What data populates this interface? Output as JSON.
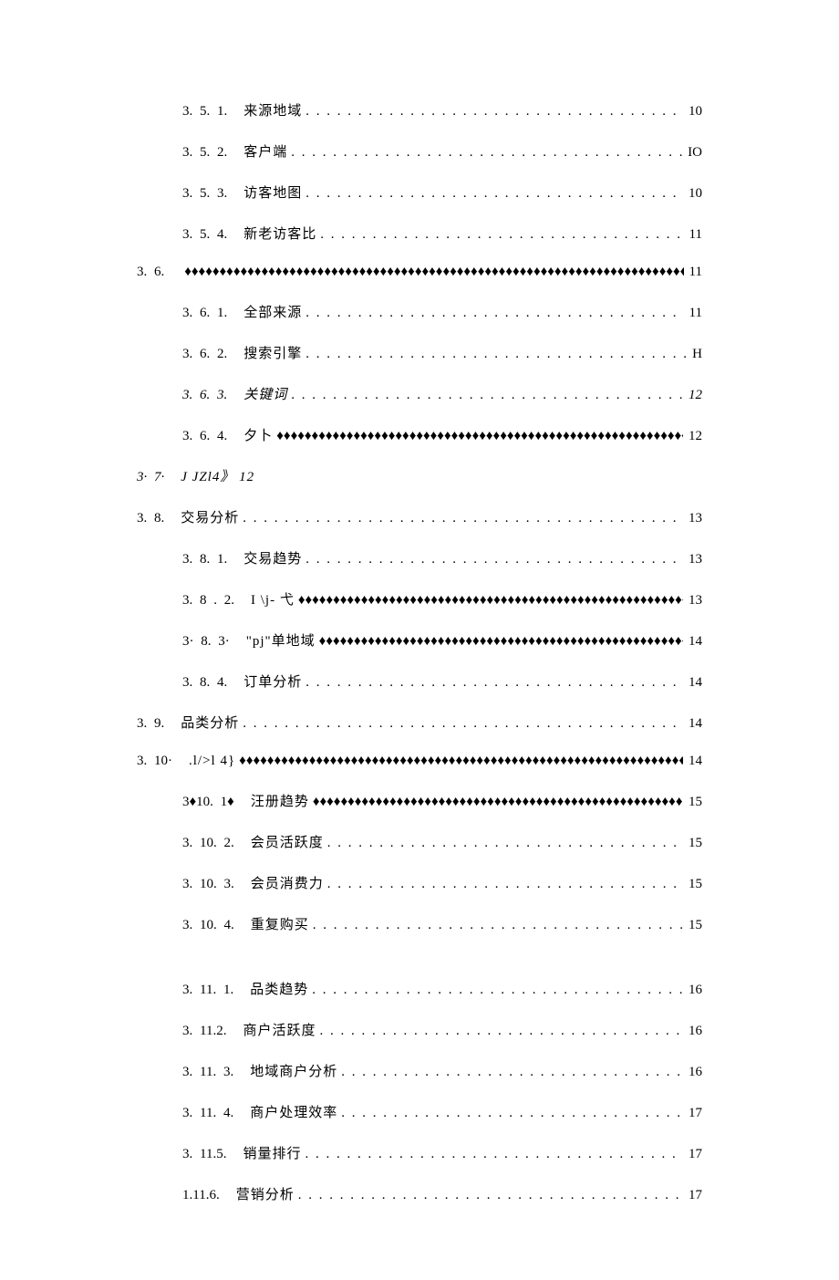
{
  "toc": [
    {
      "indent": 2,
      "num": "3. 5. 1.",
      "title": "来源地域",
      "leader": "dots",
      "page": "10",
      "italic": false
    },
    {
      "indent": 2,
      "num": "3. 5.  2.",
      "title": "客户端",
      "leader": "dots",
      "page": "IO",
      "italic": false
    },
    {
      "indent": 2,
      "num": "3. 5.  3.",
      "title": "访客地图",
      "leader": "dots",
      "page": "10",
      "italic": false
    },
    {
      "indent": 2,
      "num": "3. 5.  4.",
      "title": "新老访客比",
      "leader": "dots",
      "page": "11",
      "italic": false
    },
    {
      "indent": 1,
      "num": "3. 6.",
      "title": "",
      "leader": "diam",
      "page": "11",
      "italic": false
    },
    {
      "indent": 2,
      "num": "3. 6.  1.",
      "title": "全部来源",
      "leader": "dots",
      "page": "11",
      "italic": false
    },
    {
      "indent": 2,
      "num": "3. 6.  2.",
      "title": "搜索引擎",
      "leader": "dots",
      "page": "H",
      "italic": false
    },
    {
      "indent": 2,
      "num": "3. 6.  3.",
      "title": "关键词",
      "leader": "dots",
      "page": "12",
      "italic": true
    },
    {
      "indent": 2,
      "num": "3. 6. 4.",
      "title": "夕卜",
      "leader": "diam",
      "page": "12",
      "italic": false
    },
    {
      "indent": 1,
      "num": "3· 7·",
      "title": "J JZl4》 12",
      "leader": "none",
      "page": "",
      "italic": true
    },
    {
      "indent": 1,
      "num": "3. 8.",
      "title": "交易分析",
      "leader": "dots",
      "page": "13",
      "italic": false
    },
    {
      "indent": 2,
      "num": "3. 8. 1.",
      "title": "交易趋势",
      "leader": "dots",
      "page": "13",
      "italic": false
    },
    {
      "indent": 2,
      "num": "3. 8 . 2.",
      "title": "I \\j- 弋",
      "leader": "diam",
      "page": "13",
      "italic": false
    },
    {
      "indent": 2,
      "num": "3· 8. 3·",
      "title": "\"pj\"单地域",
      "leader": "diam",
      "page": "14",
      "italic": false
    },
    {
      "indent": 2,
      "num": "3. 8. 4.",
      "title": "订单分析",
      "leader": "dots",
      "page": "14",
      "italic": false
    },
    {
      "indent": 1,
      "num": "3. 9.",
      "title": "品类分析",
      "leader": "dots",
      "page": "14",
      "italic": false
    },
    {
      "indent": 1,
      "num": "3. 10·",
      "title": ".l/>l 4}",
      "leader": "diam",
      "page": "14",
      "italic": false
    },
    {
      "indent": 2,
      "num": "3♦10. 1♦",
      "title": "汪册趋势",
      "leader": "diam",
      "page": "15",
      "italic": false
    },
    {
      "indent": 2,
      "num": "3. 10.  2.",
      "title": "会员活跃度",
      "leader": "dots",
      "page": "15",
      "italic": false
    },
    {
      "indent": 2,
      "num": "3. 10.  3.",
      "title": "会员消费力",
      "leader": "dots",
      "page": "15",
      "italic": false
    },
    {
      "indent": 2,
      "num": "3. 10.  4.",
      "title": "重复购买",
      "leader": "dots",
      "page": "15",
      "italic": false
    },
    {
      "gap": true
    },
    {
      "indent": 2,
      "num": "3. 11.  1.",
      "title": "品类趋势",
      "leader": "dots",
      "page": "16",
      "italic": false
    },
    {
      "indent": 2,
      "num": "3. 11.2.",
      "title": "商户活跃度",
      "leader": "dots",
      "page": "16",
      "italic": false
    },
    {
      "indent": 2,
      "num": "3. 11.  3.",
      "title": "地域商户分析",
      "leader": "dots",
      "page": "16",
      "italic": false
    },
    {
      "indent": 2,
      "num": "3. 11.  4.",
      "title": "商户处理效率",
      "leader": "dots",
      "page": "17",
      "italic": false
    },
    {
      "indent": 2,
      "num": "3. 11.5.",
      "title": "销量排行",
      "leader": "dots",
      "page": "17",
      "italic": false
    },
    {
      "indent": 2,
      "num": "1.11.6.",
      "title": "营销分析",
      "leader": "dots",
      "page": "17",
      "italic": false
    }
  ]
}
